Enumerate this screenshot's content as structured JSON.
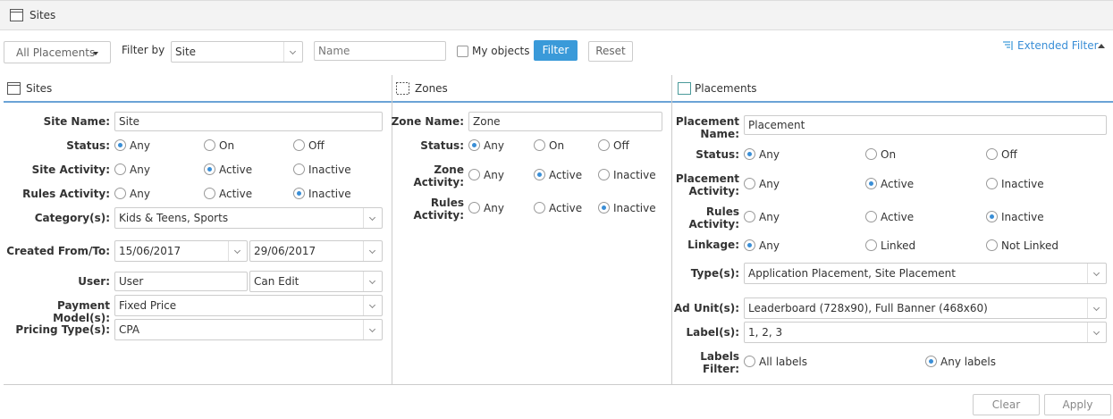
{
  "window": {
    "title": "Sites"
  },
  "toolbar": {
    "placements_dropdown": "All Placements",
    "filter_by_label": "Filter by",
    "filter_by_value": "Site",
    "name_placeholder": "Name",
    "my_objects_label": "My objects",
    "filter_button": "Filter",
    "reset_button": "Reset",
    "extended_filter_link": "Extended Filter"
  },
  "sites": {
    "title": "Sites",
    "site_name_label": "Site Name:",
    "site_name_value": "Site",
    "status_label": "Status:",
    "status_options": [
      "Any",
      "On",
      "Off"
    ],
    "status_selected": "Any",
    "site_activity_label": "Site Activity:",
    "site_activity_options": [
      "Any",
      "Active",
      "Inactive"
    ],
    "site_activity_selected": "Active",
    "rules_activity_label": "Rules Activity:",
    "rules_activity_options": [
      "Any",
      "Active",
      "Inactive"
    ],
    "rules_activity_selected": "Inactive",
    "category_label": "Category(s):",
    "category_value": "Kids & Teens, Sports",
    "created_label": "Created From/To:",
    "created_from": "15/06/2017",
    "created_to": "29/06/2017",
    "user_label": "User:",
    "user_value": "User",
    "user_permission": "Can Edit",
    "payment_label": "Payment Model(s):",
    "payment_value": "Fixed Price",
    "pricing_label": "Pricing Type(s):",
    "pricing_value": "CPA"
  },
  "zones": {
    "title": "Zones",
    "zone_name_label": "Zone Name:",
    "zone_name_value": "Zone",
    "status_label": "Status:",
    "status_options": [
      "Any",
      "On",
      "Off"
    ],
    "status_selected": "Any",
    "zone_activity_label_1": "Zone",
    "zone_activity_label_2": "Activity:",
    "zone_activity_options": [
      "Any",
      "Active",
      "Inactive"
    ],
    "zone_activity_selected": "Active",
    "rules_activity_label_1": "Rules",
    "rules_activity_label_2": "Activity:",
    "rules_activity_options": [
      "Any",
      "Active",
      "Inactive"
    ],
    "rules_activity_selected": "Inactive"
  },
  "placements": {
    "title": "Placements",
    "placement_name_label_1": "Placement",
    "placement_name_label_2": "Name:",
    "placement_name_value": "Placement",
    "status_label": "Status:",
    "status_options": [
      "Any",
      "On",
      "Off"
    ],
    "status_selected": "Any",
    "placement_activity_label_1": "Placement",
    "placement_activity_label_2": "Activity:",
    "placement_activity_options": [
      "Any",
      "Active",
      "Inactive"
    ],
    "placement_activity_selected": "Active",
    "rules_activity_label_1": "Rules",
    "rules_activity_label_2": "Activity:",
    "rules_activity_options": [
      "Any",
      "Active",
      "Inactive"
    ],
    "rules_activity_selected": "Inactive",
    "linkage_label": "Linkage:",
    "linkage_options": [
      "Any",
      "Linked",
      "Not Linked"
    ],
    "linkage_selected": "Any",
    "types_label": "Type(s):",
    "types_value": "Application Placement, Site Placement",
    "ad_unit_label": "Ad Unit(s):",
    "ad_unit_value": "Leaderboard (728x90), Full Banner (468x60)",
    "labels_label": "Label(s):",
    "labels_value": "1, 2, 3",
    "labels_filter_label_1": "Labels",
    "labels_filter_label_2": "Filter:",
    "labels_filter_options": [
      "All labels",
      "Any labels"
    ],
    "labels_filter_selected": "Any labels"
  },
  "footer": {
    "clear_button": "Clear",
    "apply_button": "Apply"
  },
  "colors": {
    "accent": "#3a9ad9",
    "header_rule": "#6ba3d6"
  }
}
